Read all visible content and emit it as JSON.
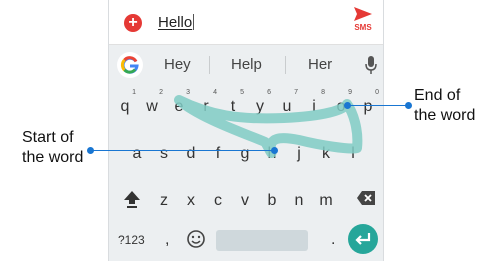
{
  "compose": {
    "message_text": "Hello",
    "send_label": "SMS"
  },
  "suggestions": [
    "Hey",
    "Help",
    "Her"
  ],
  "keyboard": {
    "row1": [
      {
        "key": "q",
        "hint": "1"
      },
      {
        "key": "w",
        "hint": "2"
      },
      {
        "key": "e",
        "hint": "3"
      },
      {
        "key": "r",
        "hint": "4"
      },
      {
        "key": "t",
        "hint": "5"
      },
      {
        "key": "y",
        "hint": "6"
      },
      {
        "key": "u",
        "hint": "7"
      },
      {
        "key": "i",
        "hint": "8"
      },
      {
        "key": "o",
        "hint": "9"
      },
      {
        "key": "p",
        "hint": "0"
      }
    ],
    "row2": [
      "a",
      "s",
      "d",
      "f",
      "g",
      "h",
      "j",
      "k",
      "l"
    ],
    "row3": [
      "z",
      "x",
      "c",
      "v",
      "b",
      "n",
      "m"
    ],
    "symbols_label": "?123",
    "comma_label": ",",
    "period_label": "."
  },
  "annotations": {
    "start_label_line1": "Start of",
    "start_label_line2": "the word",
    "end_label_line1": "End of",
    "end_label_line2": "the word"
  },
  "colors": {
    "accent_red": "#e53935",
    "enter_teal": "#26a69a",
    "trail_teal": "#80cbc4",
    "callout_blue": "#1976d2"
  },
  "icons": {
    "add": "plus-circle-icon",
    "send": "send-icon",
    "google": "google-g-icon",
    "mic": "microphone-icon",
    "shift": "shift-arrow-icon",
    "backspace": "backspace-icon",
    "emoji": "emoji-smiley-icon",
    "enter": "enter-return-icon"
  }
}
